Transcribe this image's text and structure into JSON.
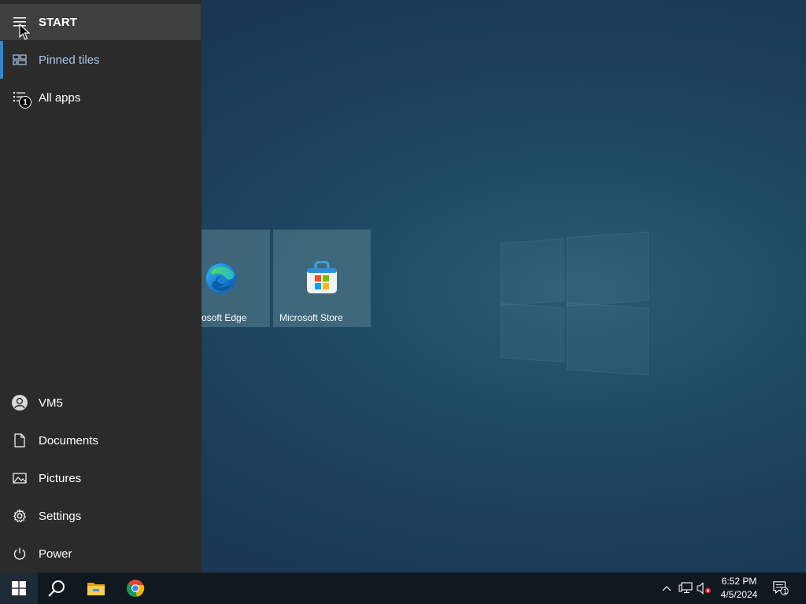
{
  "start_menu": {
    "title": "START",
    "nav": {
      "pinned_tiles": "Pinned tiles",
      "all_apps": "All apps",
      "all_apps_badge": "1"
    },
    "bottom": {
      "user": "VM5",
      "documents": "Documents",
      "pictures": "Pictures",
      "settings": "Settings",
      "power": "Power"
    }
  },
  "tiles": [
    {
      "label": "osoft Edge",
      "icon": "edge-icon"
    },
    {
      "label": "Microsoft Store",
      "icon": "store-icon"
    }
  ],
  "taskbar": {
    "pinned_apps": [
      "search-icon",
      "file-explorer-icon",
      "chrome-icon"
    ],
    "tray_icons": [
      "chevron-up-icon",
      "network-icon",
      "volume-muted-icon"
    ],
    "time": "6:52 PM",
    "date": "4/5/2024",
    "notification_count": "1"
  },
  "colors": {
    "accent": "#2f8ad6",
    "panel": "#2b2b2b",
    "taskbar": "#101820"
  }
}
